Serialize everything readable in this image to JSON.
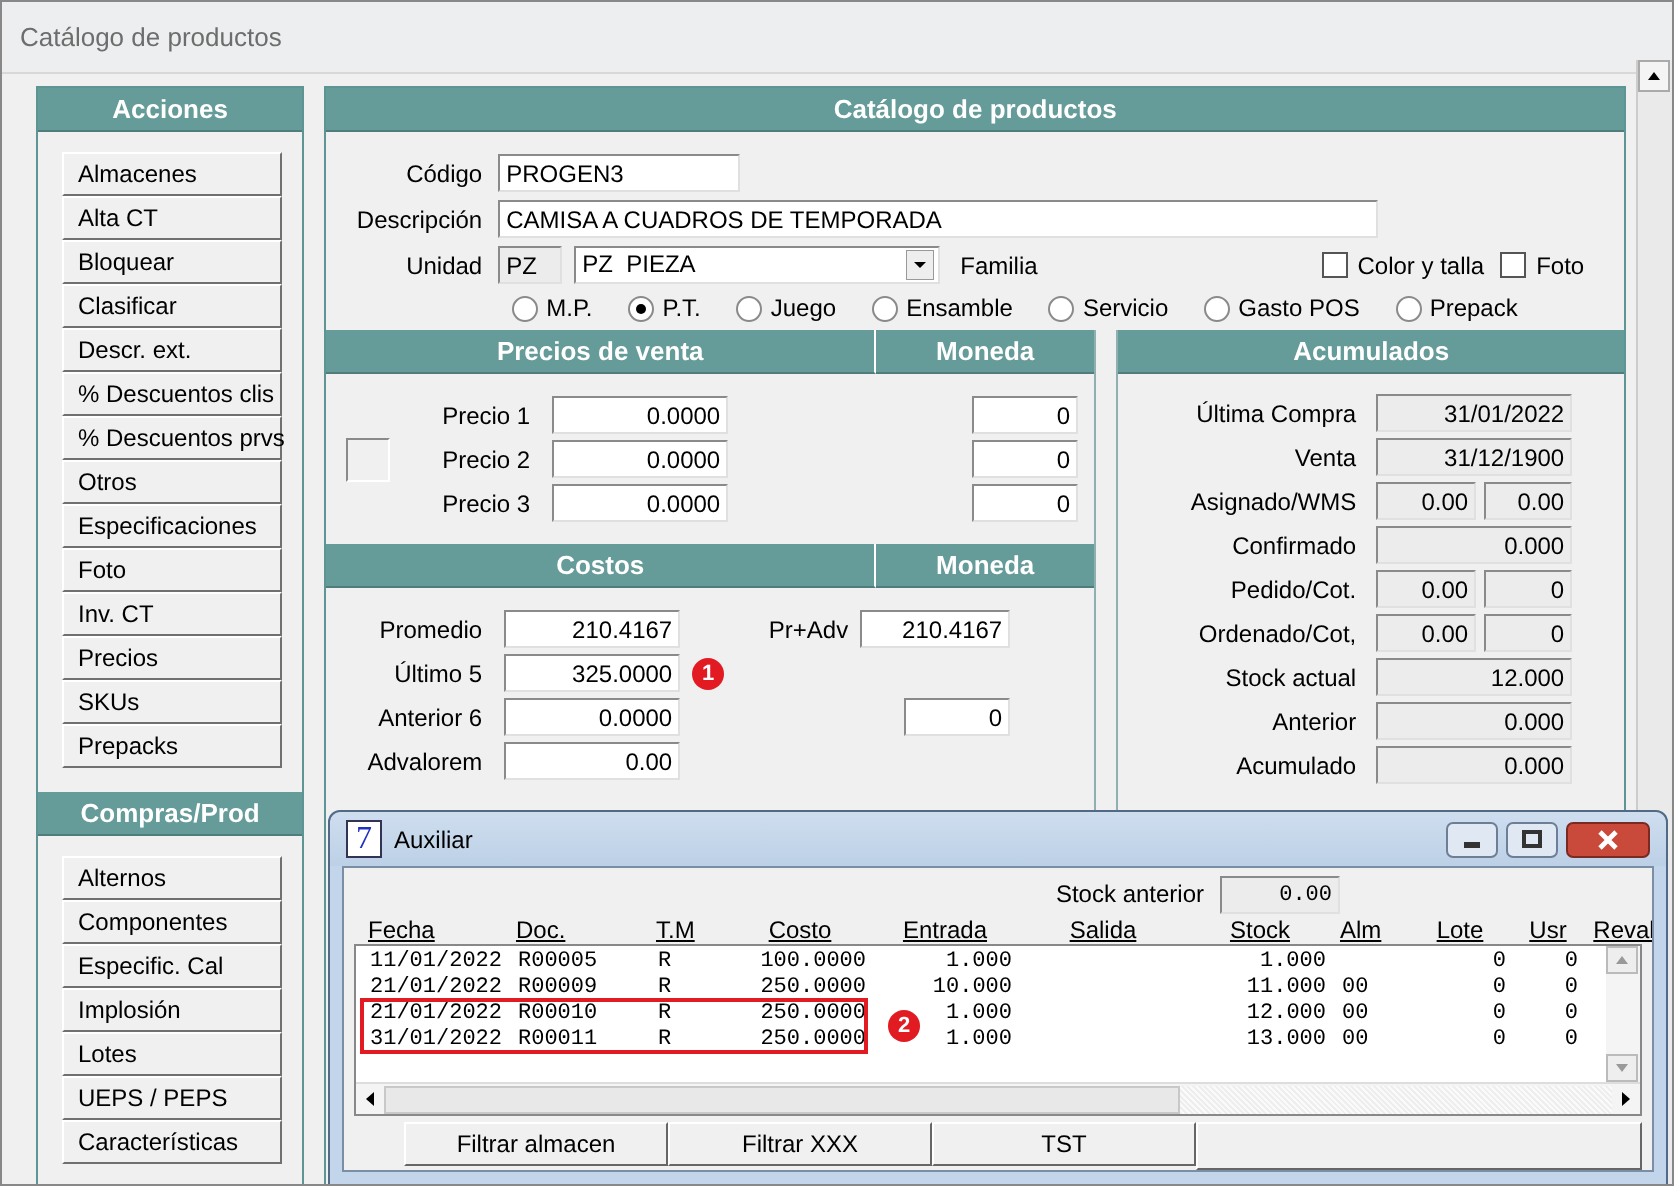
{
  "window": {
    "title": "Catálogo de productos"
  },
  "sidebar": [
    {
      "title": "Acciones",
      "items": [
        "Almacenes",
        "Alta CT",
        "Bloquear",
        "Clasificar",
        "Descr. ext.",
        "% Descuentos clis",
        "% Descuentos prvs",
        "Otros",
        "Especificaciones",
        "Foto",
        "Inv. CT",
        "Precios",
        "SKUs",
        "Prepacks"
      ]
    },
    {
      "title": "Compras/Prod",
      "items": [
        "Alternos",
        "Componentes",
        "Especific. Cal",
        "Implosión",
        "Lotes",
        "UEPS / PEPS",
        "Características"
      ]
    }
  ],
  "form": {
    "title": "Catálogo de productos",
    "codigo": {
      "label": "Código",
      "value": "PROGEN3"
    },
    "descripcion": {
      "label": "Descripción",
      "value": "CAMISA A CUADROS DE TEMPORADA"
    },
    "unidad": {
      "label": "Unidad",
      "code": "PZ",
      "value": "PZ  PIEZA"
    },
    "familia": "Familia",
    "checkboxes": [
      {
        "label": "Color y talla",
        "checked": false
      },
      {
        "label": "Foto",
        "checked": false
      }
    ],
    "types": [
      {
        "label": "M.P.",
        "selected": false
      },
      {
        "label": "P.T.",
        "selected": true
      },
      {
        "label": "Juego",
        "selected": false
      },
      {
        "label": "Ensamble",
        "selected": false
      },
      {
        "label": "Servicio",
        "selected": false
      },
      {
        "label": "Gasto POS",
        "selected": false
      },
      {
        "label": "Prepack",
        "selected": false
      }
    ]
  },
  "precios": {
    "title": "Precios de venta",
    "currency_title": "Moneda",
    "rows": [
      {
        "label": "Precio 1",
        "value": "0.0000",
        "currency": "0"
      },
      {
        "label": "Precio 2",
        "value": "0.0000",
        "currency": "0"
      },
      {
        "label": "Precio 3",
        "value": "0.0000",
        "currency": "0"
      }
    ]
  },
  "costos": {
    "title": "Costos",
    "currency_title": "Moneda",
    "rows": [
      {
        "label": "Promedio",
        "value": "210.4167",
        "extra_label": "Pr+Adv",
        "extra_value": "210.4167"
      },
      {
        "label": "Último 5",
        "value": "325.0000",
        "annotation": "1"
      },
      {
        "label": "Anterior 6",
        "value": "0.0000",
        "currency": "0"
      },
      {
        "label": "Advalorem",
        "value": "0.00"
      }
    ]
  },
  "acumulados": {
    "title": "Acumulados",
    "rows": [
      {
        "label": "Última Compra",
        "values": [
          "31/01/2022"
        ]
      },
      {
        "label": "Venta",
        "values": [
          "31/12/1900"
        ]
      },
      {
        "label": "Asignado/WMS",
        "values": [
          "0.00",
          "0.00"
        ]
      },
      {
        "label": "Confirmado",
        "values": [
          "0.000"
        ]
      },
      {
        "label": "Pedido/Cot.",
        "values": [
          "0.00",
          "0"
        ]
      },
      {
        "label": "Ordenado/Cot,",
        "values": [
          "0.00",
          "0"
        ]
      },
      {
        "label": "Stock actual",
        "values": [
          "12.000"
        ]
      },
      {
        "label": "Anterior",
        "values": [
          "0.000"
        ]
      },
      {
        "label": "Acumulado",
        "values": [
          "0.000"
        ]
      }
    ]
  },
  "auxiliar": {
    "app_icon": "7",
    "title": "Auxiliar",
    "stock_label": "Stock anterior",
    "stock_value": "0.00",
    "columns": [
      "Fecha",
      "Doc.",
      "T.M",
      "Costo",
      "Entrada",
      "Salida",
      "Stock",
      "Alm",
      "Lote",
      "Usr",
      "Reval"
    ],
    "rows": [
      {
        "cells": [
          "11/01/2022",
          "R00005",
          "R",
          "100.0000",
          "1.000",
          null,
          "1.000",
          null,
          "0",
          "0",
          null
        ],
        "marked": false
      },
      {
        "cells": [
          "21/01/2022",
          "R00009",
          "R",
          "250.0000",
          "10.000",
          null,
          "11.000",
          "00",
          "0",
          "0",
          null
        ],
        "marked": false
      },
      {
        "cells": [
          "21/01/2022",
          "R00010",
          "R",
          "250.0000",
          "1.000",
          null,
          "12.000",
          "00",
          "0",
          "0",
          null
        ],
        "marked": true
      },
      {
        "cells": [
          "31/01/2022",
          "R00011",
          "R",
          "250.0000",
          "1.000",
          null,
          "13.000",
          "00",
          "0",
          "0",
          null
        ],
        "marked": true
      }
    ],
    "annotation": "2",
    "buttons": [
      "Filtrar  almacen",
      "Filtrar XXX",
      "TST"
    ]
  }
}
